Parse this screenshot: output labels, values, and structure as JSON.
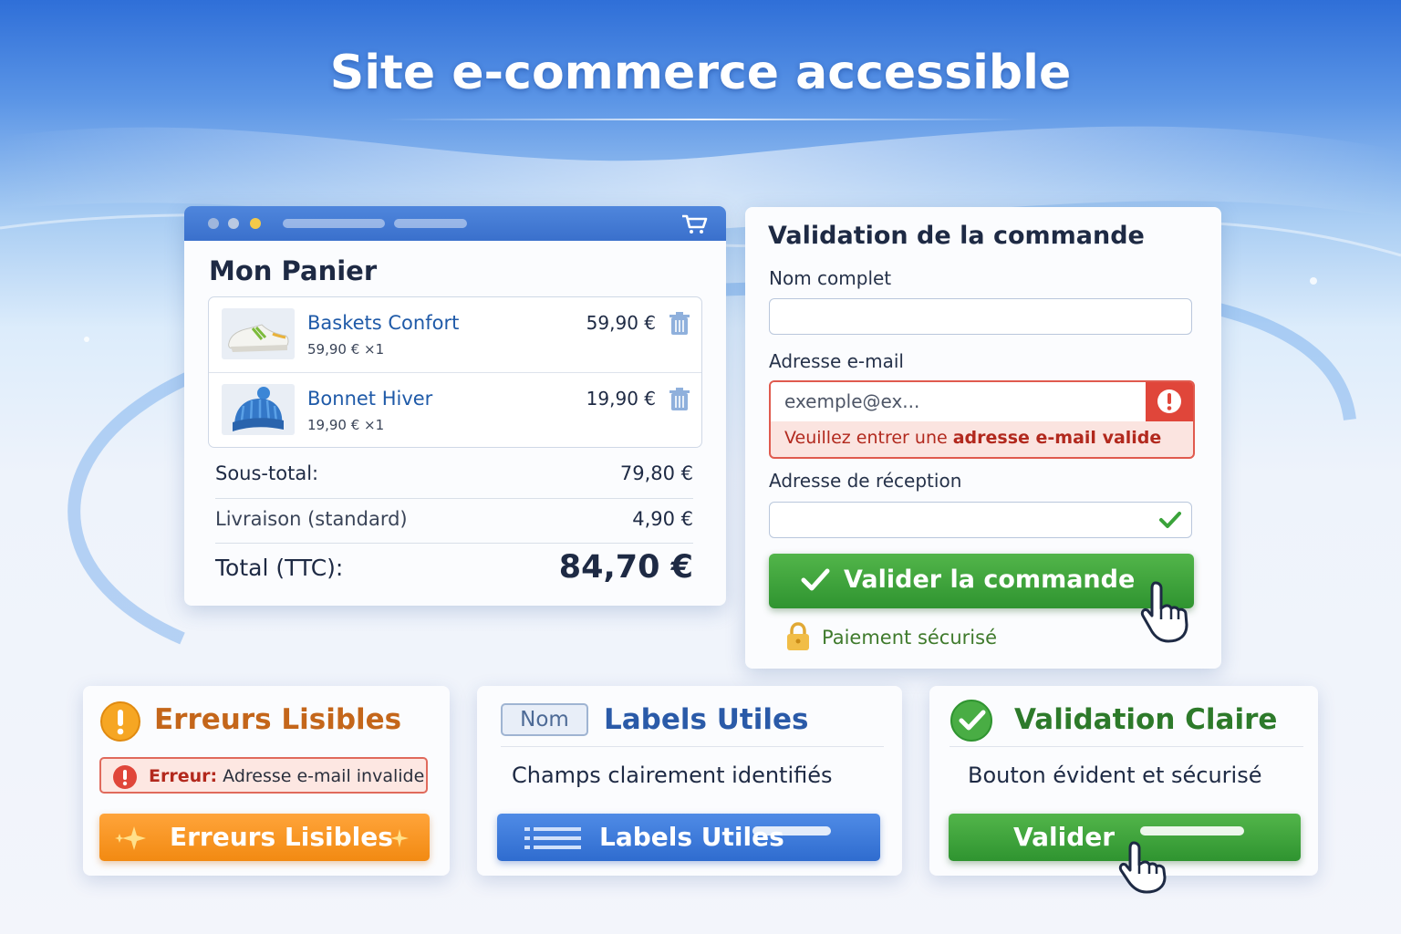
{
  "page": {
    "title": "Site e-commerce accessible"
  },
  "cart": {
    "title": "Mon Panier",
    "items": [
      {
        "name": "Baskets Confort",
        "unit": "59,90 € ×1",
        "price": "59,90 €",
        "thumb_icon": "sneaker-icon"
      },
      {
        "name": "Bonnet Hiver",
        "unit": "19,90 € ×1",
        "price": "19,90 €",
        "thumb_icon": "beanie-icon"
      }
    ],
    "subtotal_label": "Sous-total:",
    "subtotal_value": "79,80 €",
    "shipping_label": "Livraison (standard)",
    "shipping_value": "4,90 €",
    "total_label": "Total (TTC):",
    "total_value": "84,70 €"
  },
  "order": {
    "title": "Validation de la commande",
    "name_label": "Nom complet",
    "name_value": "",
    "email_label": "Adresse e-mail",
    "email_placeholder": "exemple@ex...",
    "email_error_prefix": "Veuillez entrer une ",
    "email_error_bold": "adresse e-mail valide",
    "shipping_address_label": "Adresse de réception",
    "shipping_address_value": "",
    "submit_label": "Valider la commande",
    "secure_label": "Paiement sécurisé"
  },
  "cards": {
    "errors": {
      "title": "Erreurs Lisibles",
      "chip_prefix": "Erreur:",
      "chip_text": " Adresse e-mail invalide",
      "button_label": "Erreurs Lisibles"
    },
    "labels": {
      "tag": "Nom",
      "title": "Labels Utiles",
      "text": "Champs clairement identifiés",
      "button_label": "Labels Utiles"
    },
    "validation": {
      "title": "Validation Claire",
      "text": "Bouton évident et sécurisé",
      "button_label": "Valider"
    }
  },
  "colors": {
    "primary_blue": "#3a70cc",
    "success_green": "#2f9430",
    "error_red": "#e0463a",
    "warning_orange": "#f28a12"
  }
}
